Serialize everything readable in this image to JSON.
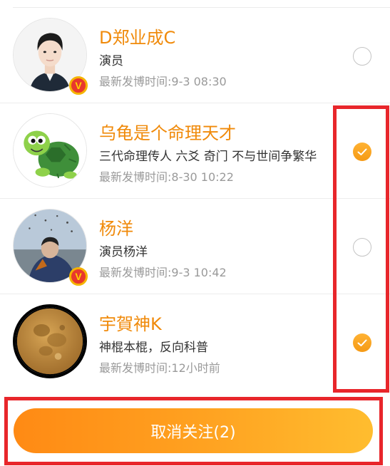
{
  "users": [
    {
      "name": "D郑业成C",
      "bio": "演员",
      "last_post": "最新发博时间:9-3 08:30",
      "verified": true,
      "selected": false,
      "avatar": "person-portrait"
    },
    {
      "name": "乌龟是个命理天才",
      "bio": "三代命理传人 六爻 奇门 不与世间争繁华",
      "last_post": "最新发博时间:8-30 10:22",
      "verified": false,
      "selected": true,
      "avatar": "cartoon-turtle"
    },
    {
      "name": "杨洋",
      "bio": "演员杨洋",
      "last_post": "最新发博时间:9-3 10:42",
      "verified": true,
      "selected": false,
      "avatar": "person-outdoor"
    },
    {
      "name": "宇賀神K",
      "bio": "神棍本棍，反向科普",
      "last_post": "最新发博时间:12小时前",
      "verified": false,
      "selected": true,
      "avatar": "full-moon"
    }
  ],
  "verified_badge": "V",
  "unfollow_button": {
    "label": "取消关注(2)"
  },
  "colors": {
    "accent": "#f08a0a",
    "highlight": "#e8262b",
    "button_start": "#ff8a14",
    "button_end": "#ffbd2f"
  }
}
